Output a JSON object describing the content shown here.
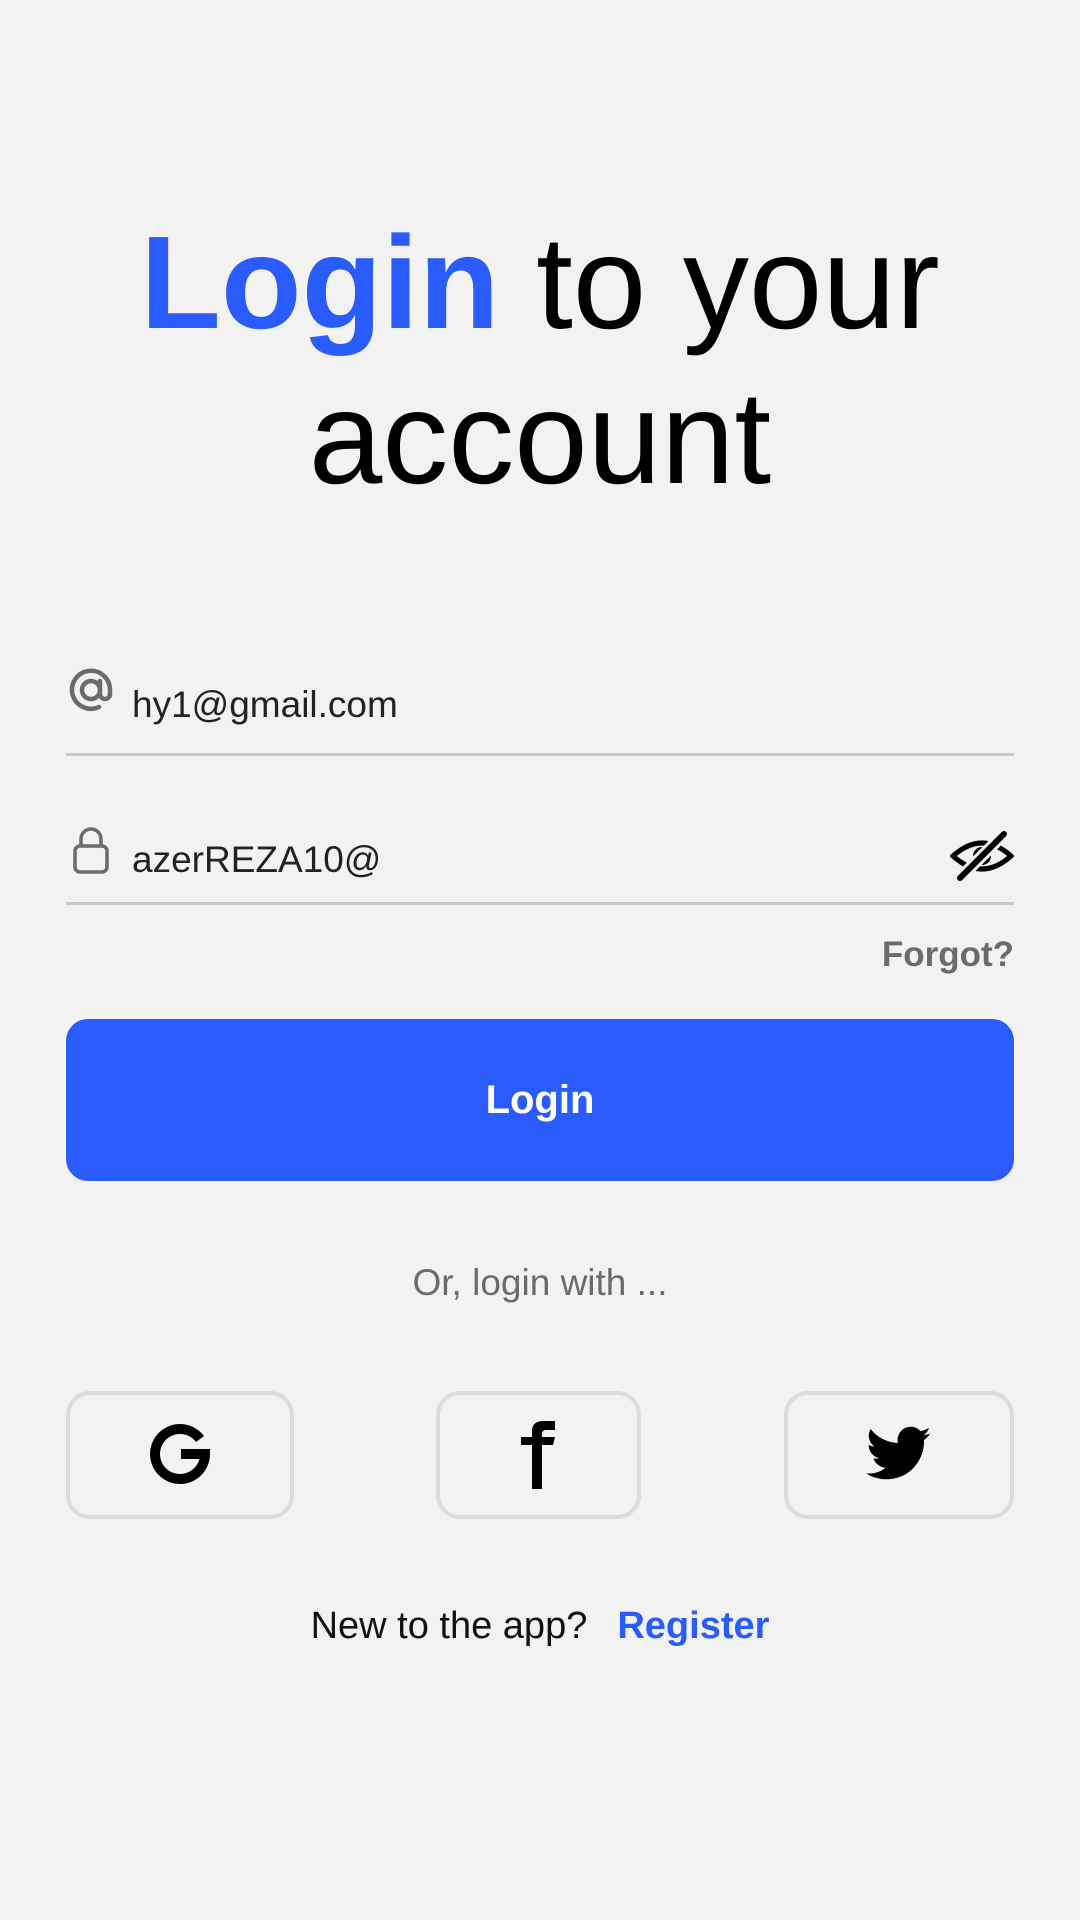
{
  "header": {
    "title_accent": "Login",
    "title_rest_line1": " to your",
    "title_line2": "account"
  },
  "form": {
    "email_value": "hy1@gmail.com",
    "password_value": "azerREZA10@",
    "forgot_label": "Forgot?",
    "login_label": "Login"
  },
  "social": {
    "divider_text": "Or, login with ...",
    "providers": [
      {
        "name": "Google",
        "icon": "google-icon"
      },
      {
        "name": "Facebook",
        "icon": "facebook-icon"
      },
      {
        "name": "Twitter",
        "icon": "twitter-icon"
      }
    ]
  },
  "footer": {
    "question": "New to the app?",
    "register_label": "Register"
  },
  "colors": {
    "accent": "#2a5bfd",
    "background": "#f2f2f2",
    "muted_text": "#6b6b6b",
    "divider": "#c8c8c8"
  }
}
